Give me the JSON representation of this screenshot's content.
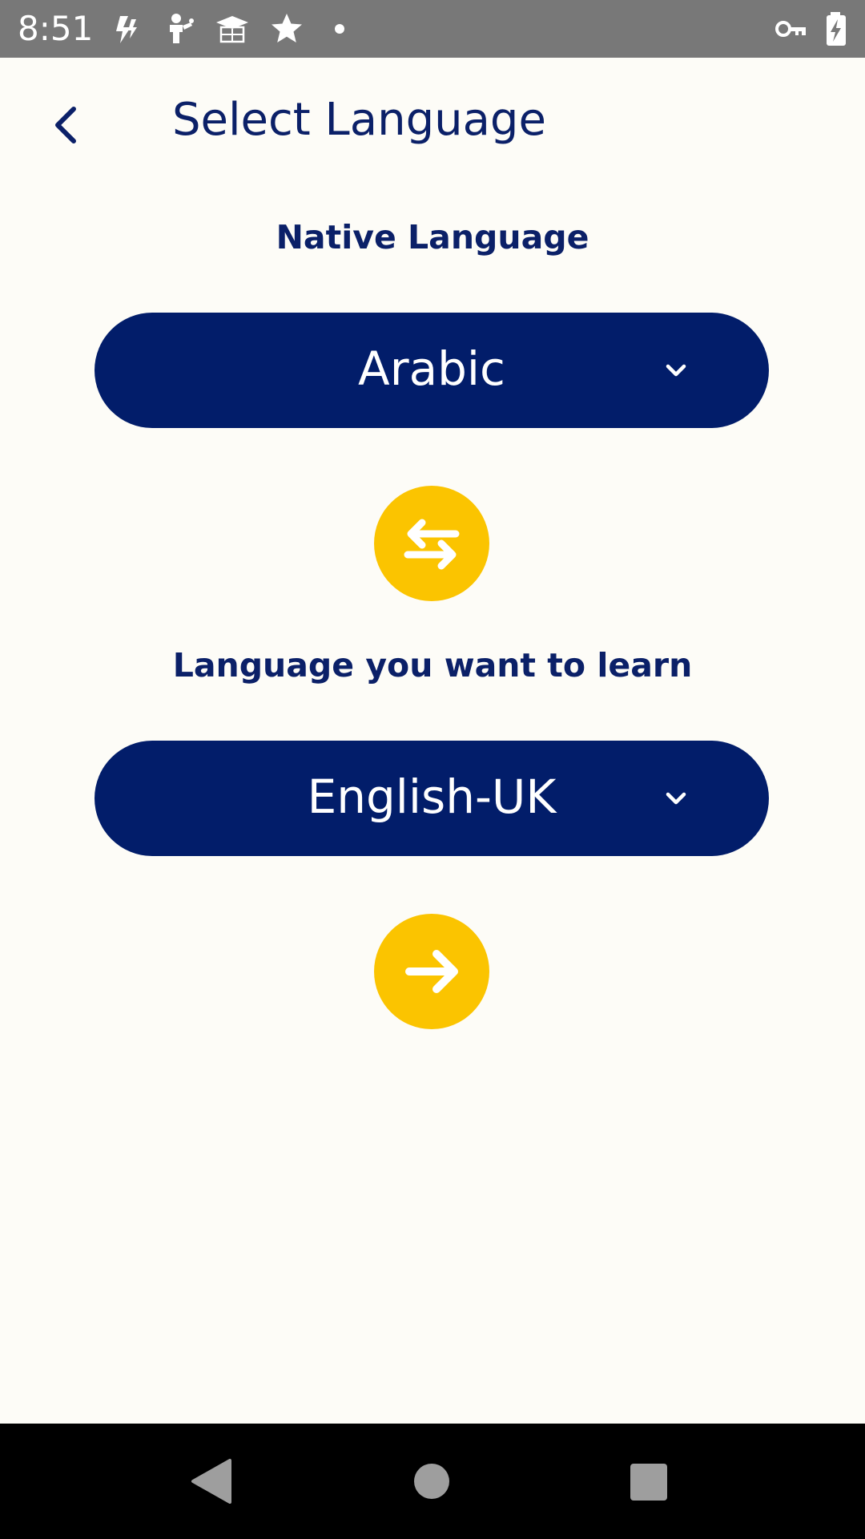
{
  "status_bar": {
    "time": "8:51",
    "icons": [
      "lightning-app-icon",
      "fitness-app-icon",
      "graduation-cap-icon",
      "star-icon",
      "notification-dot-icon",
      "vpn-key-icon",
      "battery-charging-icon"
    ]
  },
  "header": {
    "title": "Select Language",
    "back_icon": "chevron-left-icon"
  },
  "native": {
    "label": "Native Language",
    "value": "Arabic"
  },
  "learn": {
    "label": "Language you want to learn",
    "value": "English-UK"
  },
  "buttons": {
    "swap_icon": "swap-arrows-icon",
    "next_icon": "arrow-right-icon"
  },
  "navigation": {
    "icons": [
      "back-triangle-icon",
      "home-circle-icon",
      "recents-square-icon"
    ]
  },
  "colors": {
    "primary": "#021d6a",
    "title": "#0b2068",
    "accent": "#fbc400",
    "background": "#fdfcf7",
    "status_bar": "#787878",
    "nav_bar": "#000000"
  }
}
